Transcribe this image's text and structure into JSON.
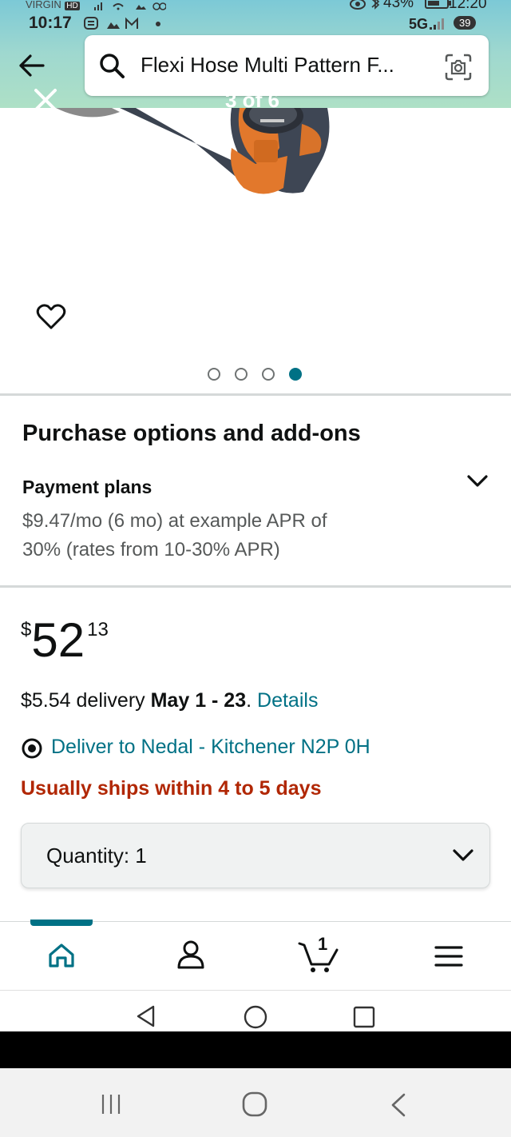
{
  "status": {
    "carrier": "VIRGIN",
    "hd_badge": "HD",
    "time": "10:17",
    "battery": "43%",
    "clock2": "12:20",
    "network": "5G",
    "badge_count": "39"
  },
  "header": {
    "search_text": "Flexi Hose Multi Pattern F...",
    "image_counter": "3 of 6"
  },
  "carousel": {
    "total": 4,
    "active_index": 3
  },
  "purchase": {
    "title": "Purchase options and add-ons",
    "payment_label": "Payment plans",
    "payment_line1": "$9.47/mo (6 mo) at example APR of",
    "payment_line2": "30% (rates from 10-30% APR)"
  },
  "price": {
    "currency": "$",
    "whole": "52",
    "fraction": "13"
  },
  "delivery": {
    "fee": "$5.54 delivery ",
    "date": "May 1 - 23",
    "period": ". ",
    "details_link": "Details",
    "deliver_to": "Deliver to Nedal - Kitchener N2P 0H",
    "ships_note": "Usually ships within 4 to 5 days"
  },
  "quantity": {
    "label": "Quantity:",
    "value": "1"
  },
  "nav": {
    "cart_count": "1"
  },
  "colors": {
    "link": "#007185",
    "ships_note": "#b12704",
    "active_tab": "#007185"
  }
}
